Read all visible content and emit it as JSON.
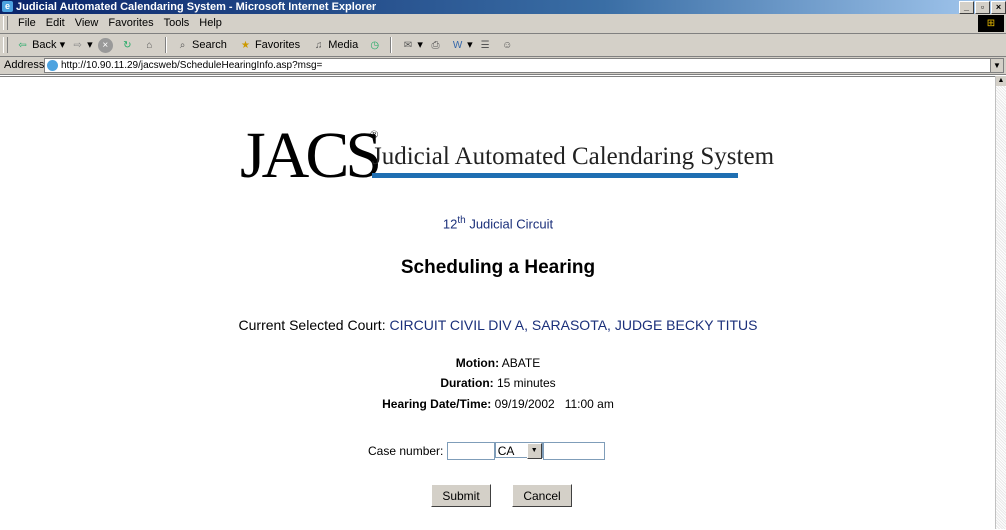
{
  "window": {
    "title": "Judicial Automated Calendaring System - Microsoft Internet Explorer",
    "buttons": [
      "_",
      "▫",
      "×"
    ]
  },
  "menu": [
    "File",
    "Edit",
    "View",
    "Favorites",
    "Tools",
    "Help"
  ],
  "toolbar": {
    "back": "Back",
    "search": "Search",
    "favorites": "Favorites",
    "media": "Media"
  },
  "address": {
    "label": "Address",
    "url": "http://10.90.11.29/jacsweb/ScheduleHearingInfo.asp?msg="
  },
  "logo": {
    "mark": "JACS",
    "registered": "®",
    "tagline": "Judicial Automated Calendaring System"
  },
  "circuit": {
    "number": "12",
    "suffix": "th",
    "text": "Judicial Circuit"
  },
  "heading": "Scheduling a Hearing",
  "court": {
    "label": "Current Selected Court:",
    "value": "CIRCUIT CIVIL DIV A, SARASOTA, JUDGE BECKY TITUS"
  },
  "details": {
    "motion_label": "Motion:",
    "motion": "ABATE",
    "duration_label": "Duration:",
    "duration": "15 minutes",
    "datetime_label": "Hearing Date/Time:",
    "datetime": "09/19/2002   11:00 am"
  },
  "case": {
    "label": "Case number:",
    "year": "",
    "type": "CA",
    "number": ""
  },
  "buttons": {
    "submit": "Submit",
    "cancel": "Cancel"
  }
}
